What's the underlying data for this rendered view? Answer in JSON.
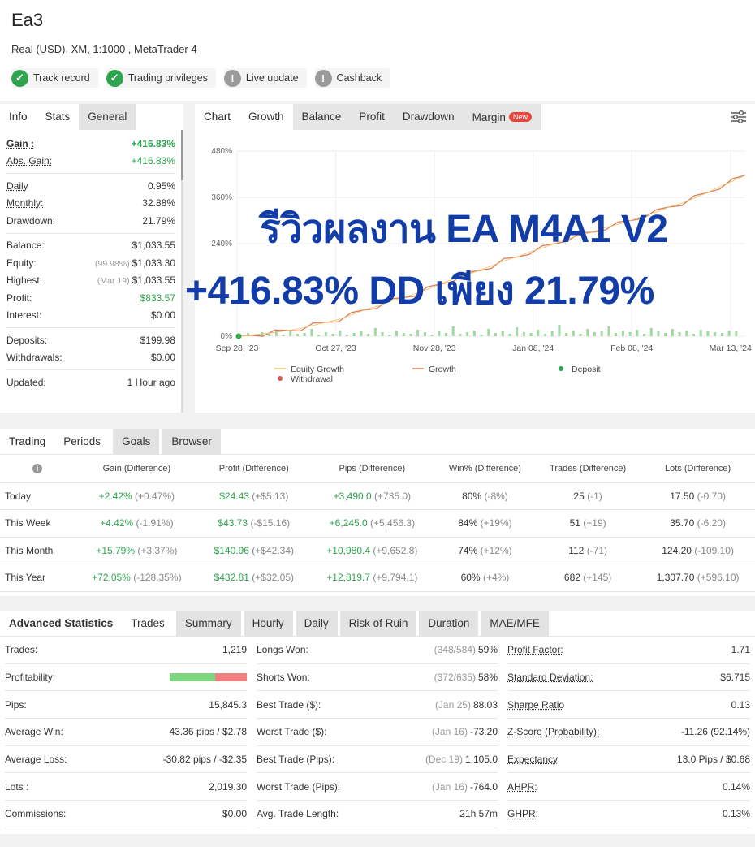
{
  "header": {
    "title": "Ea3",
    "account_prefix": "Real (USD), ",
    "broker": "XM",
    "account_suffix": ", 1:1000 , MetaTrader 4",
    "badges": [
      {
        "label": "Track record",
        "status": "ok"
      },
      {
        "label": "Trading privileges",
        "status": "ok"
      },
      {
        "label": "Live update",
        "status": "warn"
      },
      {
        "label": "Cashback",
        "status": "warn"
      }
    ]
  },
  "info_panel": {
    "tabs": [
      "Info",
      "Stats",
      "General"
    ],
    "rows": {
      "gain": {
        "label": "Gain :",
        "value": "+416.83%"
      },
      "abs_gain": {
        "label": "Abs. Gain:",
        "value": "+416.83%"
      },
      "daily": {
        "label": "Daily",
        "value": "0.95%"
      },
      "monthly": {
        "label": "Monthly:",
        "value": "32.88%"
      },
      "drawdown": {
        "label": "Drawdown:",
        "value": "21.79%"
      },
      "balance": {
        "label": "Balance:",
        "value": "$1,033.55"
      },
      "equity": {
        "label": "Equity:",
        "note": "(99.98%)",
        "value": "$1,033.30"
      },
      "highest": {
        "label": "Highest:",
        "note": "(Mar 19)",
        "value": "$1,033.55"
      },
      "profit": {
        "label": "Profit:",
        "value": "$833.57"
      },
      "interest": {
        "label": "Interest:",
        "value": "$0.00"
      },
      "deposits": {
        "label": "Deposits:",
        "value": "$199.98"
      },
      "withdrawals": {
        "label": "Withdrawals:",
        "value": "$0.00"
      },
      "updated": {
        "label": "Updated:",
        "value": "1 Hour ago"
      }
    }
  },
  "chart_panel": {
    "tabs": [
      "Chart",
      "Growth",
      "Balance",
      "Profit",
      "Drawdown",
      "Margin"
    ],
    "new_badge": "New",
    "overlay_line1": "รีวิวผลงาน EA M4A1 V2",
    "overlay_line2": "+416.83% DD เพียง 21.79%",
    "legend": {
      "equity": "Equity Growth",
      "growth": "Growth",
      "deposit": "Deposit",
      "withdrawal": "Withdrawal"
    }
  },
  "chart_data": {
    "type": "line",
    "y_ticks": [
      "480%",
      "360%",
      "240%",
      "0%"
    ],
    "ylim": [
      0,
      480
    ],
    "x_ticks": [
      "Sep 28, '23",
      "Oct 27, '23",
      "Nov 28, '23",
      "Jan 08, '24",
      "Feb 08, '24",
      "Mar 13, '24"
    ],
    "series": [
      {
        "name": "Growth",
        "color": "#e07b54",
        "values": [
          0,
          3,
          6,
          10,
          15,
          20,
          28,
          36,
          44,
          55,
          68,
          78,
          90,
          100,
          110,
          122,
          135,
          148,
          158,
          170,
          182,
          195,
          205,
          218,
          228,
          240,
          252,
          262,
          270,
          282,
          290,
          300,
          312,
          322,
          335,
          345,
          358,
          372,
          388,
          402,
          417
        ]
      },
      {
        "name": "Equity Growth",
        "color": "#e9c46a",
        "values": [
          0,
          3,
          6,
          10,
          15,
          20,
          28,
          36,
          44,
          55,
          68,
          78,
          90,
          100,
          110,
          122,
          135,
          148,
          158,
          170,
          182,
          195,
          205,
          218,
          228,
          240,
          252,
          262,
          270,
          282,
          290,
          300,
          312,
          322,
          335,
          345,
          358,
          372,
          388,
          402,
          417
        ]
      }
    ],
    "bars": [
      4,
      2,
      5,
      3,
      6,
      2,
      8,
      3,
      4,
      9,
      2,
      5,
      3,
      7,
      2,
      4,
      6,
      3,
      10,
      5,
      2,
      7,
      4,
      3,
      8,
      5,
      2,
      6,
      4,
      12,
      3,
      5,
      7,
      2,
      9,
      4,
      6,
      3,
      11,
      5,
      4,
      8,
      3,
      6,
      14,
      4,
      7,
      3,
      9,
      5,
      6,
      12,
      4,
      7,
      5,
      8,
      3,
      10,
      6,
      4,
      9,
      5,
      7,
      3,
      8,
      6,
      5,
      4,
      7,
      6
    ],
    "markers": {
      "deposit_color": "#2ea44f",
      "withdrawal_color": "#d9534f"
    }
  },
  "trading_panel": {
    "tabs": [
      "Trading",
      "Periods",
      "Goals",
      "Browser"
    ],
    "headers": [
      "Gain (Difference)",
      "Profit (Difference)",
      "Pips (Difference)",
      "Win% (Difference)",
      "Trades (Difference)",
      "Lots (Difference)"
    ],
    "rows": [
      {
        "label": "Today",
        "gain": "+2.42%",
        "gain_d": "(+0.47%)",
        "profit": "$24.43",
        "profit_d": "(+$5.13)",
        "pips": "+3,490.0",
        "pips_d": "(+735.0)",
        "win": "80%",
        "win_d": "(-8%)",
        "trades": "25",
        "trades_d": "(-1)",
        "lots": "17.50",
        "lots_d": "(-0.70)"
      },
      {
        "label": "This Week",
        "gain": "+4.42%",
        "gain_d": "(-1.91%)",
        "profit": "$43.73",
        "profit_d": "(-$15.16)",
        "pips": "+6,245.0",
        "pips_d": "(+5,456.3)",
        "win": "84%",
        "win_d": "(+19%)",
        "trades": "51",
        "trades_d": "(+19)",
        "lots": "35.70",
        "lots_d": "(-6.20)"
      },
      {
        "label": "This Month",
        "gain": "+15.79%",
        "gain_d": "(+3.37%)",
        "profit": "$140.96",
        "profit_d": "(+$42.34)",
        "pips": "+10,980.4",
        "pips_d": "(+9,652.8)",
        "win": "74%",
        "win_d": "(+12%)",
        "trades": "112",
        "trades_d": "(-71)",
        "lots": "124.20",
        "lots_d": "(-109.10)"
      },
      {
        "label": "This Year",
        "gain": "+72.05%",
        "gain_d": "(-128.35%)",
        "profit": "$432.81",
        "profit_d": "(+$32.05)",
        "pips": "+12,819.7",
        "pips_d": "(+9,794.1)",
        "win": "60%",
        "win_d": "(+4%)",
        "trades": "682",
        "trades_d": "(+145)",
        "lots": "1,307.70",
        "lots_d": "(+596.10)"
      }
    ]
  },
  "advanced_panel": {
    "tabs": [
      "Advanced Statistics",
      "Trades",
      "Summary",
      "Hourly",
      "Daily",
      "Risk of Ruin",
      "Duration",
      "MAE/MFE"
    ],
    "col1": [
      {
        "label": "Trades:",
        "value": "1,219"
      },
      {
        "label": "Profitability:",
        "value": ""
      },
      {
        "label": "Pips:",
        "value": "15,845.3"
      },
      {
        "label": "Average Win:",
        "value": "43.36 pips / $2.78"
      },
      {
        "label": "Average Loss:",
        "value": "-30.82 pips / -$2.35"
      },
      {
        "label": "Lots :",
        "value": "2,019.30"
      },
      {
        "label": "Commissions:",
        "value": "$0.00"
      }
    ],
    "profitability_win_fraction": 0.59,
    "col2": [
      {
        "label": "Longs Won:",
        "note": "(348/584)",
        "value": "59%"
      },
      {
        "label": "Shorts Won:",
        "note": "(372/635)",
        "value": "58%"
      },
      {
        "label": "Best Trade ($):",
        "note": "(Jan 25)",
        "value": "88.03"
      },
      {
        "label": "Worst Trade ($):",
        "note": "(Jan 16)",
        "value": "-73.20"
      },
      {
        "label": "Best Trade (Pips):",
        "note": "(Dec 19)",
        "value": "1,105.0"
      },
      {
        "label": "Worst Trade (Pips):",
        "note": "(Jan 16)",
        "value": "-764.0"
      },
      {
        "label": "Avg. Trade Length:",
        "note": "",
        "value": "21h 57m"
      }
    ],
    "col3": [
      {
        "label": "Profit Factor:",
        "value": "1.71"
      },
      {
        "label": "Standard Deviation:",
        "value": "$6.715"
      },
      {
        "label": "Sharpe Ratio",
        "value": "0.13"
      },
      {
        "label": "Z-Score (Probability):",
        "value": "-11.26 (92.14%)"
      },
      {
        "label": "Expectancy",
        "value": "13.0 Pips / $0.68"
      },
      {
        "label": "AHPR:",
        "value": "0.14%"
      },
      {
        "label": "GHPR:",
        "value": "0.13%"
      }
    ]
  }
}
